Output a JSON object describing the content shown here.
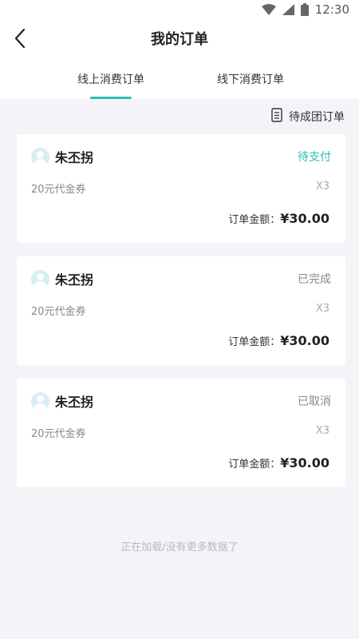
{
  "status_bar": {
    "time": "12:30"
  },
  "header": {
    "title": "我的订单",
    "back_icon": "back-arrow-icon"
  },
  "tabs": [
    {
      "label": "线上消费订单",
      "active": true
    },
    {
      "label": "线下消费订单",
      "active": false
    }
  ],
  "group_order_link": {
    "label": "待成团订单",
    "icon": "document-list-icon"
  },
  "orders": [
    {
      "user": "朱丕拐",
      "status": "待支付",
      "item": "20元代金券",
      "quantity": "X3",
      "amount_label": "订单金额：",
      "amount": "¥30.00"
    },
    {
      "user": "朱丕拐",
      "status": "已完成",
      "item": "20元代金券",
      "quantity": "X3",
      "amount_label": "订单金额：",
      "amount": "¥30.00"
    },
    {
      "user": "朱丕拐",
      "status": "已取消",
      "item": "20元代金券",
      "quantity": "X3",
      "amount_label": "订单金额：",
      "amount": "¥30.00"
    }
  ],
  "footer": {
    "loading_text": "正在加载/没有更多数据了"
  },
  "colors": {
    "accent": "#2bbdb5",
    "background": "#f4f4f8"
  }
}
